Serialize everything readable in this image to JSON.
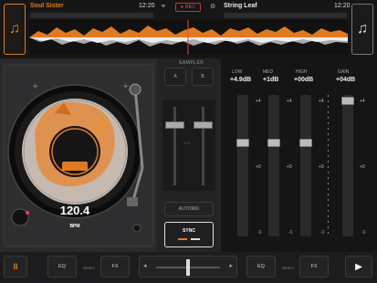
{
  "deck_a": {
    "title": "Soul Sister",
    "time": "12:20",
    "icon": "music-note-icon"
  },
  "deck_b": {
    "title": "String Leaf",
    "time": "12:20",
    "icon": "music-note-icon"
  },
  "record": {
    "label": "● REC"
  },
  "sampler": {
    "label": "SAMPLER",
    "slot_a": "A",
    "slot_b": "B"
  },
  "turntable": {
    "bpm": "120.4",
    "bpm_label": "BPM"
  },
  "center": {
    "automix": "AUTOMIX",
    "sync": "SYNC",
    "vol_label": "VOL"
  },
  "eq": {
    "columns": [
      {
        "label": "LOW",
        "value": "+4.9dB"
      },
      {
        "label": "MED",
        "value": "+1dB"
      },
      {
        "label": "HIGH",
        "value": "+00dB"
      },
      {
        "label": "GAIN",
        "value": "+04dB"
      }
    ],
    "scale": {
      "top": "+4",
      "mid": "+0",
      "bottom": "-1"
    },
    "gain_scale": {
      "top": "+4",
      "mid": "+0",
      "bottom": "-1"
    }
  },
  "bottom": {
    "pause": "II",
    "eq_a": "EQ",
    "reset_a": "RESET",
    "fx_a": "FX",
    "eq_b": "EQ",
    "reset_b": "RESET",
    "fx_b": "FX",
    "play": "▶",
    "cross_left": "◂",
    "cross_right": "▸"
  },
  "colors": {
    "accent": "#e07a22",
    "rec": "#e44444"
  }
}
